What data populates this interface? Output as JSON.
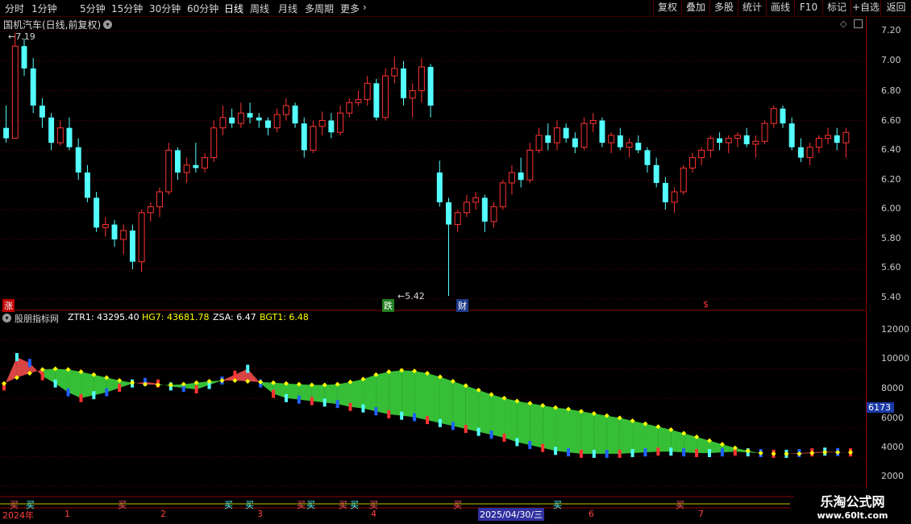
{
  "toolbar": {
    "periods": [
      "分时",
      "1分钟",
      "5分钟",
      "15分钟",
      "30分钟",
      "60分钟",
      "日线",
      "周线",
      "月线",
      "多周期",
      "更多"
    ],
    "right_buttons": [
      "复权",
      "叠加",
      "多股",
      "统计",
      "画线",
      "F10",
      "标记",
      "+自选",
      "返回"
    ]
  },
  "main": {
    "title": "国机汽车(日线,前复权)",
    "high_label": "7.19",
    "low_label": "5.42",
    "price_ticks": [
      "7.20",
      "7.00",
      "6.80",
      "6.60",
      "6.40",
      "6.20",
      "6.00",
      "5.80",
      "5.60",
      "5.40"
    ],
    "badges": {
      "zhang": "涨",
      "die": "跌",
      "cai": "财",
      "dollar": "$"
    }
  },
  "indicator": {
    "name": "股朋指标网",
    "params": [
      {
        "label": "ZTR1: 43295.40",
        "color": "#ffffff"
      },
      {
        "label": "HG7: 43681.78",
        "color": "#ffff00"
      },
      {
        "label": "ZSA: 6.47",
        "color": "#ffffff"
      },
      {
        "label": "BGT1: 6.48",
        "color": "#ffff00"
      }
    ],
    "ticks": [
      "12000",
      "10000",
      "8000",
      "6000",
      "4000",
      "2000"
    ],
    "current_value": "6173"
  },
  "timeline": {
    "labels": [
      "2024年",
      "1",
      "2",
      "3",
      "4",
      "2025/04/30/三",
      "6",
      "7"
    ],
    "markers": [
      "买",
      "买",
      "买",
      "买",
      "买",
      "买",
      "买",
      "买",
      "买",
      "买",
      "买",
      "买",
      "买"
    ]
  },
  "watermark": {
    "line1": "乐淘公式网",
    "line2": "www.60lt.com"
  },
  "colors": {
    "up": "#ff3232",
    "down": "#54ffff",
    "accent": "#ffff00"
  },
  "chart_data": {
    "type": "candlestick",
    "ylim": [
      5.35,
      7.28
    ],
    "candles": [
      [
        6.55,
        6.7,
        6.45,
        6.48
      ],
      [
        6.48,
        7.19,
        6.48,
        7.1
      ],
      [
        7.1,
        7.15,
        6.9,
        6.95
      ],
      [
        6.95,
        7.02,
        6.65,
        6.7
      ],
      [
        6.7,
        6.75,
        6.55,
        6.62
      ],
      [
        6.62,
        6.65,
        6.4,
        6.45
      ],
      [
        6.45,
        6.6,
        6.43,
        6.55
      ],
      [
        6.55,
        6.62,
        6.4,
        6.42
      ],
      [
        6.42,
        6.48,
        6.2,
        6.25
      ],
      [
        6.25,
        6.3,
        6.05,
        6.08
      ],
      [
        6.08,
        6.12,
        5.85,
        5.88
      ],
      [
        5.88,
        5.95,
        5.82,
        5.9
      ],
      [
        5.9,
        5.93,
        5.75,
        5.8
      ],
      [
        5.8,
        5.9,
        5.7,
        5.86
      ],
      [
        5.86,
        5.9,
        5.6,
        5.65
      ],
      [
        5.65,
        6.0,
        5.58,
        5.98
      ],
      [
        5.98,
        6.05,
        5.92,
        6.02
      ],
      [
        6.02,
        6.15,
        5.95,
        6.12
      ],
      [
        6.12,
        6.45,
        6.1,
        6.4
      ],
      [
        6.4,
        6.42,
        6.2,
        6.25
      ],
      [
        6.25,
        6.35,
        6.18,
        6.3
      ],
      [
        6.3,
        6.45,
        6.25,
        6.28
      ],
      [
        6.28,
        6.38,
        6.25,
        6.35
      ],
      [
        6.35,
        6.6,
        6.32,
        6.55
      ],
      [
        6.55,
        6.7,
        6.5,
        6.62
      ],
      [
        6.62,
        6.68,
        6.55,
        6.58
      ],
      [
        6.58,
        6.72,
        6.55,
        6.65
      ],
      [
        6.65,
        6.72,
        6.58,
        6.62
      ],
      [
        6.62,
        6.65,
        6.55,
        6.6
      ],
      [
        6.6,
        6.62,
        6.5,
        6.55
      ],
      [
        6.55,
        6.68,
        6.52,
        6.64
      ],
      [
        6.64,
        6.75,
        6.6,
        6.7
      ],
      [
        6.7,
        6.72,
        6.55,
        6.58
      ],
      [
        6.58,
        6.62,
        6.35,
        6.4
      ],
      [
        6.4,
        6.6,
        6.38,
        6.56
      ],
      [
        6.56,
        6.66,
        6.5,
        6.6
      ],
      [
        6.6,
        6.65,
        6.48,
        6.52
      ],
      [
        6.52,
        6.7,
        6.5,
        6.65
      ],
      [
        6.65,
        6.75,
        6.62,
        6.72
      ],
      [
        6.72,
        6.8,
        6.7,
        6.74
      ],
      [
        6.74,
        6.9,
        6.7,
        6.85
      ],
      [
        6.85,
        6.88,
        6.6,
        6.62
      ],
      [
        6.62,
        6.95,
        6.6,
        6.9
      ],
      [
        6.9,
        7.03,
        6.85,
        6.95
      ],
      [
        6.95,
        7.0,
        6.7,
        6.75
      ],
      [
        6.75,
        6.85,
        6.62,
        6.8
      ],
      [
        6.8,
        7.02,
        6.72,
        6.96
      ],
      [
        6.96,
        6.98,
        6.62,
        6.7
      ],
      [
        6.25,
        6.33,
        6.02,
        6.05
      ],
      [
        6.05,
        6.08,
        5.42,
        5.9
      ],
      [
        5.9,
        6.0,
        5.85,
        5.98
      ],
      [
        5.98,
        6.1,
        5.95,
        6.05
      ],
      [
        6.05,
        6.12,
        6.0,
        6.08
      ],
      [
        6.08,
        6.1,
        5.85,
        5.92
      ],
      [
        5.92,
        6.05,
        5.88,
        6.02
      ],
      [
        6.02,
        6.2,
        6.0,
        6.18
      ],
      [
        6.18,
        6.3,
        6.1,
        6.25
      ],
      [
        6.25,
        6.35,
        6.15,
        6.2
      ],
      [
        6.2,
        6.45,
        6.18,
        6.4
      ],
      [
        6.4,
        6.55,
        6.38,
        6.5
      ],
      [
        6.5,
        6.58,
        6.4,
        6.45
      ],
      [
        6.45,
        6.6,
        6.4,
        6.55
      ],
      [
        6.55,
        6.58,
        6.45,
        6.48
      ],
      [
        6.48,
        6.52,
        6.38,
        6.42
      ],
      [
        6.42,
        6.62,
        6.4,
        6.58
      ],
      [
        6.58,
        6.65,
        6.52,
        6.6
      ],
      [
        6.6,
        6.62,
        6.42,
        6.45
      ],
      [
        6.45,
        6.52,
        6.38,
        6.5
      ],
      [
        6.5,
        6.55,
        6.4,
        6.42
      ],
      [
        6.42,
        6.48,
        6.35,
        6.45
      ],
      [
        6.45,
        6.5,
        6.38,
        6.4
      ],
      [
        6.4,
        6.42,
        6.25,
        6.3
      ],
      [
        6.3,
        6.35,
        6.15,
        6.18
      ],
      [
        6.18,
        6.22,
        6.0,
        6.05
      ],
      [
        6.05,
        6.15,
        5.98,
        6.12
      ],
      [
        6.12,
        6.3,
        6.1,
        6.28
      ],
      [
        6.28,
        6.38,
        6.25,
        6.35
      ],
      [
        6.35,
        6.42,
        6.3,
        6.4
      ],
      [
        6.4,
        6.5,
        6.35,
        6.48
      ],
      [
        6.48,
        6.52,
        6.4,
        6.45
      ],
      [
        6.45,
        6.5,
        6.38,
        6.48
      ],
      [
        6.48,
        6.52,
        6.42,
        6.5
      ],
      [
        6.5,
        6.55,
        6.42,
        6.44
      ],
      [
        6.44,
        6.5,
        6.35,
        6.46
      ],
      [
        6.46,
        6.6,
        6.44,
        6.58
      ],
      [
        6.58,
        6.7,
        6.55,
        6.68
      ],
      [
        6.68,
        6.7,
        6.55,
        6.58
      ],
      [
        6.58,
        6.62,
        6.4,
        6.42
      ],
      [
        6.42,
        6.48,
        6.32,
        6.35
      ],
      [
        6.35,
        6.45,
        6.3,
        6.42
      ],
      [
        6.42,
        6.5,
        6.38,
        6.48
      ],
      [
        6.48,
        6.55,
        6.44,
        6.5
      ],
      [
        6.5,
        6.55,
        6.4,
        6.45
      ],
      [
        6.45,
        6.55,
        6.35,
        6.52
      ]
    ],
    "indicator_ylim": [
      1500,
      13000
    ],
    "yellow_line": [
      9000,
      9400,
      9700,
      9950,
      10000,
      9950,
      9800,
      9600,
      9400,
      9200,
      9050,
      8950,
      8900,
      8900,
      8950,
      9050,
      9150,
      9200,
      9200,
      9150,
      9100,
      9050,
      9000,
      8950,
      8900,
      8900,
      8950,
      9100,
      9300,
      9600,
      9800,
      9900,
      9850,
      9700,
      9450,
      9150,
      8850,
      8550,
      8250,
      8000,
      7800,
      7650,
      7500,
      7350,
      7250,
      7100,
      6950,
      6800,
      6650,
      6450,
      6250,
      6050,
      5850,
      5600,
      5350,
      5100,
      4850,
      4600,
      4400,
      4250,
      4200,
      4200,
      4200,
      4250,
      4300,
      4300,
      4300
    ],
    "price_line": [
      8800,
      10800,
      10400,
      9500,
      9000,
      8400,
      8000,
      8200,
      8400,
      8700,
      9000,
      9100,
      9000,
      8800,
      8700,
      8600,
      8900,
      9200,
      9600,
      10000,
      9000,
      8300,
      8000,
      7900,
      7800,
      7700,
      7600,
      7400,
      7300,
      7100,
      6900,
      6800,
      6700,
      6500,
      6300,
      6100,
      5900,
      5700,
      5500,
      5300,
      5000,
      4800,
      4600,
      4400,
      4300,
      4200,
      4200,
      4200,
      4200,
      4250,
      4300,
      4350,
      4350,
      4300,
      4250,
      4250,
      4300,
      4350,
      4300,
      4250,
      4200,
      4200,
      4250,
      4300,
      4350,
      4320,
      4300
    ]
  }
}
